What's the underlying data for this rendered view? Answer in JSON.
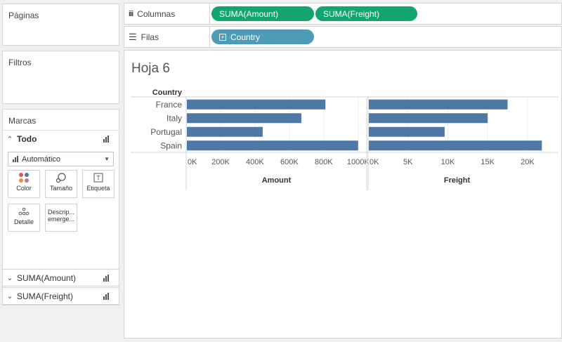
{
  "panels": {
    "pages_title": "Páginas",
    "filters_title": "Filtros",
    "marks_title": "Marcas"
  },
  "marks": {
    "all_label": "Todo",
    "mark_type": "Automático",
    "cards": {
      "color": "Color",
      "size": "Tamaño",
      "label": "Etiqueta",
      "detail": "Detalle",
      "tooltip": "Descrip... emerge..."
    },
    "measure_sections": [
      "SUMA(Amount)",
      "SUMA(Freight)"
    ]
  },
  "shelves": {
    "columns_label": "Columnas",
    "rows_label": "Filas",
    "column_pills": [
      "SUMA(Amount)",
      "SUMA(Freight)"
    ],
    "row_pills": [
      "Country"
    ]
  },
  "sheet": {
    "title": "Hoja 6"
  },
  "chart_data": {
    "type": "bar",
    "orientation": "horizontal",
    "row_header": "Country",
    "categories": [
      "France",
      "Italy",
      "Portugal",
      "Spain"
    ],
    "bar_color": "#4e79a7",
    "panes": [
      {
        "name": "Amount",
        "values": [
          810000,
          670000,
          445000,
          1000000
        ],
        "xlim": [
          0,
          1050000
        ],
        "ticks": [
          0,
          200000,
          400000,
          600000,
          800000,
          1000000
        ],
        "tick_labels": [
          "0K",
          "200K",
          "400K",
          "600K",
          "800K",
          "1000K"
        ]
      },
      {
        "name": "Freight",
        "values": [
          17500,
          15000,
          9600,
          21800
        ],
        "xlim": [
          0,
          22300
        ],
        "ticks": [
          0,
          5000,
          10000,
          15000,
          20000
        ],
        "tick_labels": [
          "0K",
          "5K",
          "10K",
          "15K",
          "20K"
        ]
      }
    ],
    "grid": true
  }
}
